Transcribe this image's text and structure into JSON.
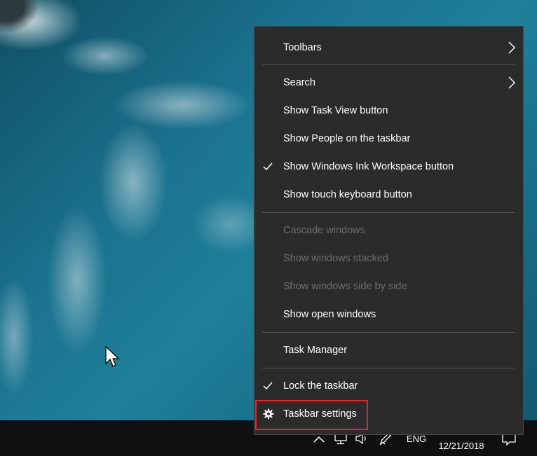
{
  "menu": {
    "items": [
      {
        "label": "Toolbars",
        "submenu": true,
        "checked": false,
        "disabled": false
      },
      {
        "label": "Search",
        "submenu": true,
        "checked": false,
        "disabled": false
      },
      {
        "label": "Show Task View button",
        "submenu": false,
        "checked": false,
        "disabled": false
      },
      {
        "label": "Show People on the taskbar",
        "submenu": false,
        "checked": false,
        "disabled": false
      },
      {
        "label": "Show Windows Ink Workspace button",
        "submenu": false,
        "checked": true,
        "disabled": false
      },
      {
        "label": "Show touch keyboard button",
        "submenu": false,
        "checked": false,
        "disabled": false
      },
      {
        "label": "Cascade windows",
        "submenu": false,
        "checked": false,
        "disabled": true
      },
      {
        "label": "Show windows stacked",
        "submenu": false,
        "checked": false,
        "disabled": true
      },
      {
        "label": "Show windows side by side",
        "submenu": false,
        "checked": false,
        "disabled": true
      },
      {
        "label": "Show open windows",
        "submenu": false,
        "checked": false,
        "disabled": false
      },
      {
        "label": "Task Manager",
        "submenu": false,
        "checked": false,
        "disabled": false
      },
      {
        "label": "Lock the taskbar",
        "submenu": false,
        "checked": true,
        "disabled": false
      },
      {
        "label": "Taskbar settings",
        "submenu": false,
        "checked": false,
        "disabled": false,
        "icon": "gear-icon"
      }
    ]
  },
  "taskbar": {
    "language": "ENG",
    "date": "12/21/2018",
    "icons": [
      "chevron-up-icon",
      "network-icon",
      "volume-icon",
      "pen-icon",
      "notification-icon"
    ]
  },
  "colors": {
    "menu_bg": "#2b2b2b",
    "menu_text": "#ffffff",
    "disabled_text": "#6d6d6d",
    "highlight_border": "#e5252a",
    "taskbar_bg": "#101010"
  }
}
